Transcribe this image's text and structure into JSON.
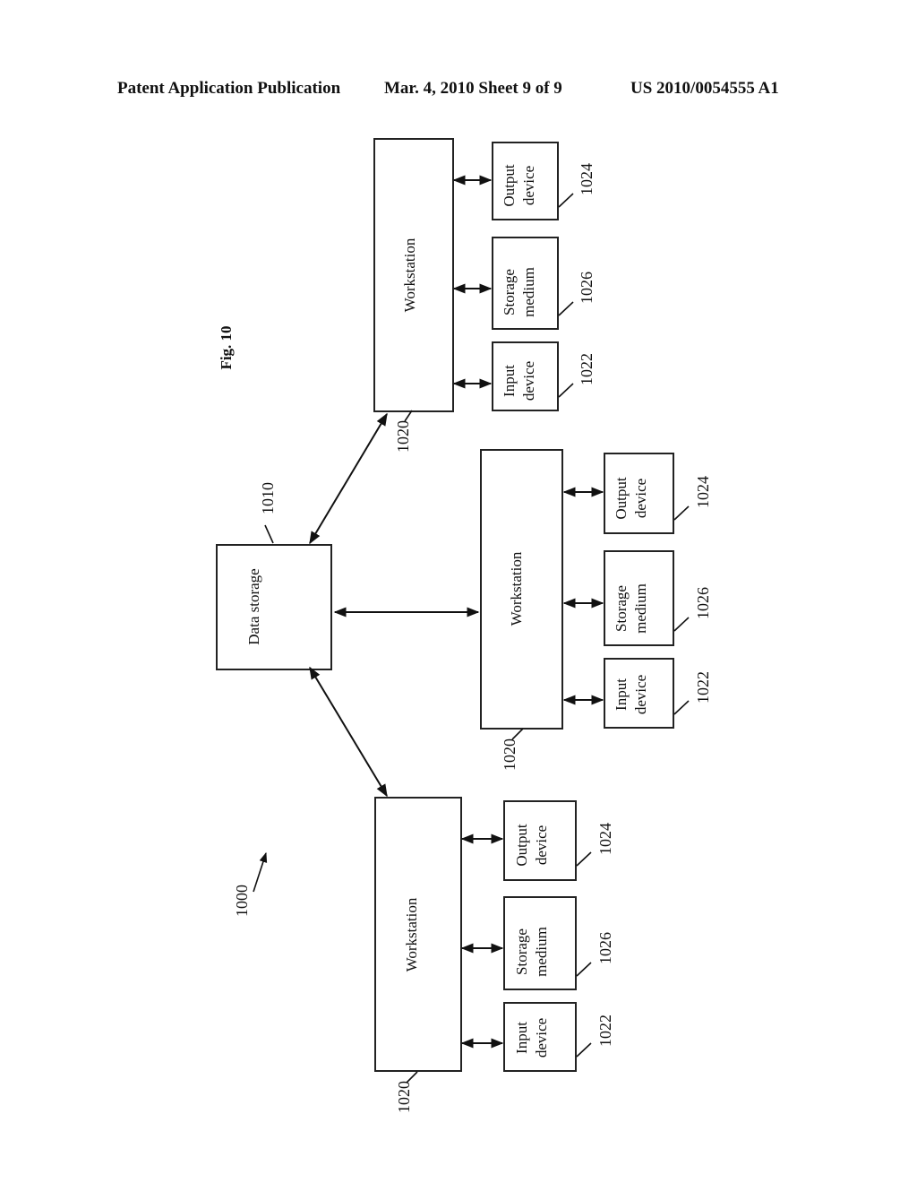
{
  "header": {
    "publication": "Patent Application Publication",
    "date_sheet": "Mar. 4, 2010   Sheet 9 of 9",
    "number": "US 2010/0054555 A1"
  },
  "figure": {
    "title": "Fig. 10",
    "system_ref": "1000",
    "data_storage": {
      "label": "Data storage",
      "ref": "1010"
    },
    "workstations": [
      {
        "label": "Workstation",
        "ref": "1020",
        "devices": [
          {
            "line1": "Output",
            "line2": "device",
            "ref": "1024"
          },
          {
            "line1": "Storage",
            "line2": "medium",
            "ref": "1026"
          },
          {
            "line1": "Input",
            "line2": "device",
            "ref": "1022"
          }
        ]
      },
      {
        "label": "Workstation",
        "ref": "1020",
        "devices": [
          {
            "line1": "Output",
            "line2": "device",
            "ref": "1024"
          },
          {
            "line1": "Storage",
            "line2": "medium",
            "ref": "1026"
          },
          {
            "line1": "Input",
            "line2": "device",
            "ref": "1022"
          }
        ]
      },
      {
        "label": "Workstation",
        "ref": "1020",
        "devices": [
          {
            "line1": "Output",
            "line2": "device",
            "ref": "1024"
          },
          {
            "line1": "Storage",
            "line2": "medium",
            "ref": "1026"
          },
          {
            "line1": "Input",
            "line2": "device",
            "ref": "1022"
          }
        ]
      }
    ]
  }
}
